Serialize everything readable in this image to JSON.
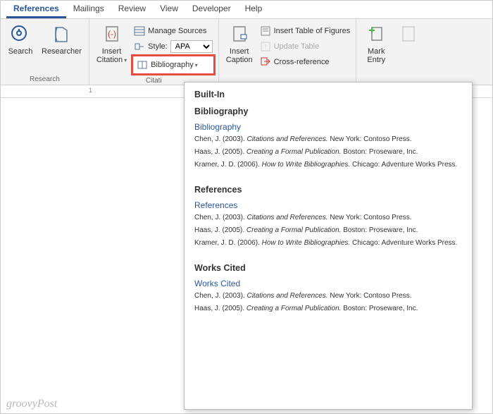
{
  "tabs": {
    "references": "References",
    "mailings": "Mailings",
    "review": "Review",
    "view": "View",
    "developer": "Developer",
    "help": "Help"
  },
  "ribbon": {
    "search": "Search",
    "researcher": "Researcher",
    "group_research": "Research",
    "insert_citation": "Insert",
    "insert_citation2": "Citation",
    "manage_sources": "Manage Sources",
    "style_label": "Style:",
    "style_value": "APA",
    "bibliography": "Bibliography",
    "group_citations": "Citati",
    "insert_caption": "Insert",
    "insert_caption2": "Caption",
    "insert_tof": "Insert Table of Figures",
    "update_table": "Update Table",
    "cross_ref": "Cross-reference",
    "mark_entry": "Mark",
    "mark_entry2": "Entry"
  },
  "ruler": {
    "one": "1"
  },
  "dropdown": {
    "builtin": "Built-In",
    "sections": [
      {
        "title": "Bibliography",
        "item_title": "Bibliography",
        "entries": [
          {
            "author": "Chen, J. (2003). ",
            "work": "Citations and References.",
            "pub": " New York: Contoso Press."
          },
          {
            "author": "Haas, J. (2005). ",
            "work": "Creating a Formal Publication.",
            "pub": " Boston: Proseware, Inc."
          },
          {
            "author": "Kramer, J. D. (2006). ",
            "work": "How to Write Bibliographies.",
            "pub": " Chicago: Adventure Works Press."
          }
        ]
      },
      {
        "title": "References",
        "item_title": "References",
        "entries": [
          {
            "author": "Chen, J. (2003). ",
            "work": "Citations and References.",
            "pub": " New York: Contoso Press."
          },
          {
            "author": "Haas, J. (2005). ",
            "work": "Creating a Formal Publication.",
            "pub": " Boston: Proseware, Inc."
          },
          {
            "author": "Kramer, J. D. (2006). ",
            "work": "How to Write Bibliographies.",
            "pub": " Chicago: Adventure Works Press."
          }
        ]
      },
      {
        "title": "Works Cited",
        "item_title": "Works Cited",
        "entries": [
          {
            "author": "Chen, J. (2003). ",
            "work": "Citations and References.",
            "pub": " New York: Contoso Press."
          },
          {
            "author": "Haas, J. (2005). ",
            "work": "Creating a Formal Publication.",
            "pub": " Boston: Proseware, Inc."
          }
        ]
      }
    ]
  },
  "watermark": "groovyPost"
}
